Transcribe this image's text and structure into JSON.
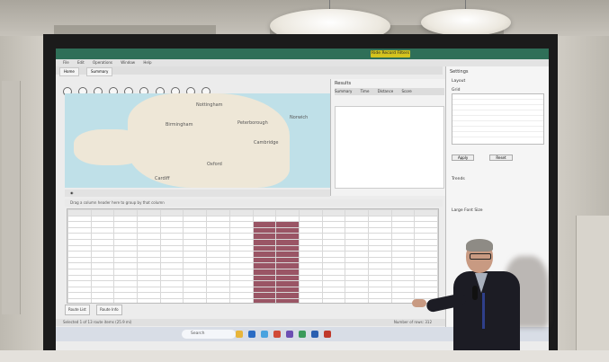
{
  "photo": {
    "subject": "presenter-pointing-at-projection-screen"
  },
  "app": {
    "title_bar": "",
    "highlight_button": "Ride Record Filters",
    "menu_items": [
      "File",
      "Edit",
      "Operations",
      "Window",
      "Help"
    ],
    "doc_tabs": [
      "Home",
      "Summary"
    ],
    "map_labels": [
      "Nottingham",
      "Birmingham",
      "Peterborough",
      "Norwich",
      "Cambridge",
      "Oxford",
      "Cardiff"
    ],
    "right_panel_title": "Results",
    "right_panel_tabs": [
      "Summary",
      "Time",
      "Distance",
      "Score"
    ],
    "filter_hint": "Drag a column header here to group by that column",
    "bottom_tabs": [
      "Route List",
      "Route Info"
    ],
    "status_left": "Selected 1 of 13 route items (25.9 mi)",
    "status_right": "Number of rows: 312",
    "taskbar_search": "Search",
    "settings": {
      "title": "Settings",
      "section_layout": "Layout",
      "section_grid": "Grid",
      "section_trends": "Trends",
      "section_large_font": "Large Font Size",
      "rows": [
        "Layout",
        "Grid",
        "Trends",
        "Large Font Size"
      ],
      "buttons": [
        "Apply",
        "Reset"
      ]
    }
  },
  "colors": {
    "title_bar": "#2f6f58",
    "highlight_button": "#d5c41e",
    "highlighted_cells": "#9a5565",
    "taskbar": "#d8dde6",
    "presenter_jacket": "#1c1c24"
  }
}
